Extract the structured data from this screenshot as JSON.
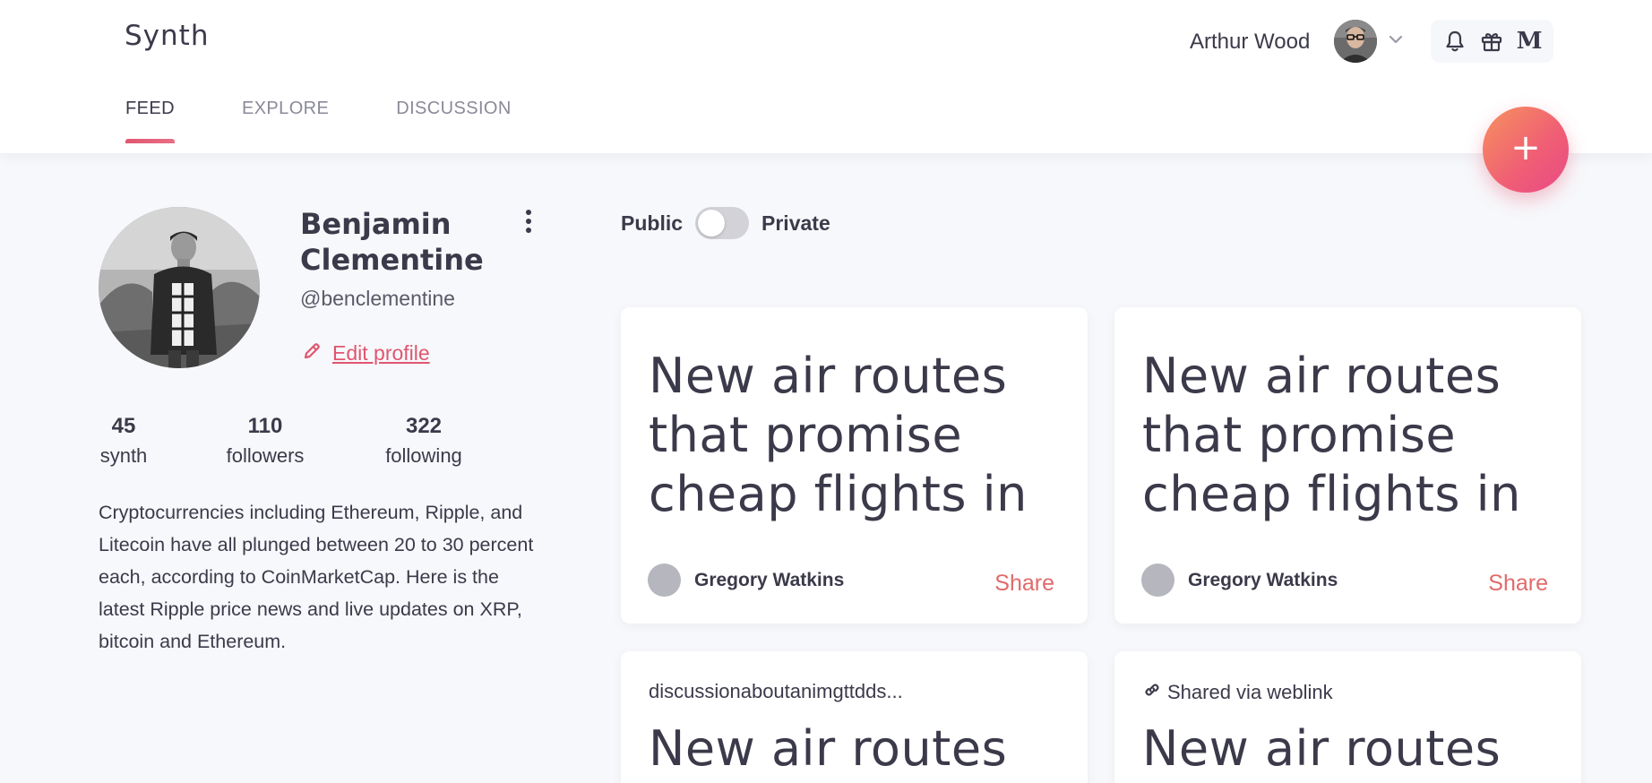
{
  "app": {
    "brand": "Synth"
  },
  "tabs": [
    {
      "label": "FEED",
      "active": true
    },
    {
      "label": "EXPLORE",
      "active": false
    },
    {
      "label": "DISCUSSION",
      "active": false
    }
  ],
  "user": {
    "name": "Arthur Wood"
  },
  "header_icons": [
    "bell-icon",
    "gift-icon",
    "medium-icon"
  ],
  "header_icon_text": {
    "medium": "M"
  },
  "fab": {
    "label": "+"
  },
  "profile": {
    "name": "Benjamin Clementine",
    "handle": "@benclementine",
    "edit_label": "Edit profile",
    "stats": [
      {
        "value": "45",
        "label": "synth"
      },
      {
        "value": "110",
        "label": "followers"
      },
      {
        "value": "322",
        "label": "following"
      }
    ],
    "bio": "Cryptocurrencies including Ethereum, Ripple, and Litecoin have all plunged between 20 to 30 percent each, according to CoinMarketCap. Here is the latest Ripple price news and live updates on XRP, bitcoin and Ethereum."
  },
  "visibility": {
    "public_label": "Public",
    "private_label": "Private",
    "is_private": false
  },
  "cards": [
    {
      "title": "New air routes that promise cheap flights in",
      "author": "Gregory Watkins",
      "share_label": "Share"
    },
    {
      "title": "New air routes that promise cheap flights in",
      "author": "Gregory Watkins",
      "share_label": "Share"
    },
    {
      "meta": "discussionaboutanimgttdds...",
      "title": "New air routes"
    },
    {
      "meta": "Shared via weblink",
      "title": "New air routes"
    }
  ],
  "colors": {
    "accent": "#e0566f",
    "share": "#e06a6a",
    "fab_start": "#f7925e",
    "fab_end": "#e94a86",
    "text": "#3b3a4a"
  }
}
